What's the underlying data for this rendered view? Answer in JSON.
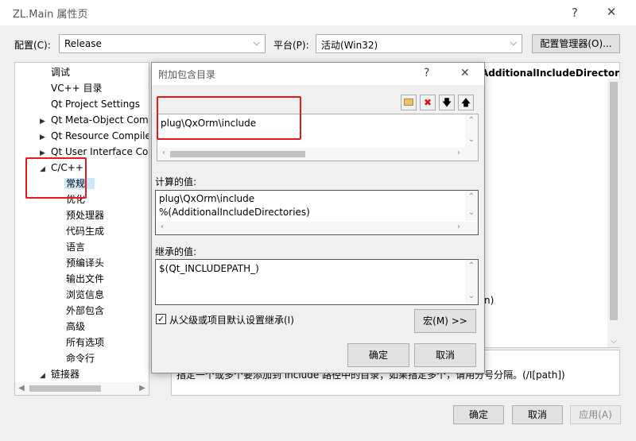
{
  "window": {
    "title": "ZL.Main 属性页",
    "help": "?",
    "close": "✕"
  },
  "config": {
    "label": "配置(C):",
    "value": "Release",
    "platform_label": "平台(P):",
    "platform_value": "活动(Win32)",
    "manager_button": "配置管理器(O)..."
  },
  "tree": {
    "items": [
      {
        "label": "调试"
      },
      {
        "label": "VC++ 目录"
      },
      {
        "label": "Qt Project Settings"
      },
      {
        "label": "Qt Meta-Object Com"
      },
      {
        "label": "Qt Resource Compile"
      },
      {
        "label": "Qt User Interface Co"
      },
      {
        "label": "C/C++"
      },
      {
        "label": "常规"
      },
      {
        "label": "优化"
      },
      {
        "label": "预处理器"
      },
      {
        "label": "代码生成"
      },
      {
        "label": "语言"
      },
      {
        "label": "预编译头"
      },
      {
        "label": "输出文件"
      },
      {
        "label": "浏览信息"
      },
      {
        "label": "外部包含"
      },
      {
        "label": "高级"
      },
      {
        "label": "所有选项"
      },
      {
        "label": "命令行"
      },
      {
        "label": "链接器"
      }
    ],
    "expand_collapsed": "▶",
    "expand_open": "◢"
  },
  "grid": {
    "header_fragment": "AdditionalIncludeDirector",
    "row_fragment": "n)"
  },
  "description": {
    "text": "指定一个或多个要添加到 include 路径中的目录；如果指定多个，请用分号分隔。(/I[path])"
  },
  "dialog": {
    "title": "附加包含目录",
    "help": "?",
    "close": "✕",
    "entry": "plug\\QxOrm\\include",
    "computed_label": "计算的值:",
    "computed_lines": [
      "plug\\QxOrm\\include",
      "%(AdditionalIncludeDirectories)"
    ],
    "inherited_label": "继承的值:",
    "inherited_value": "$(Qt_INCLUDEPATH_)",
    "inherit_checkbox": "从父级或项目默认设置继承(I)",
    "macro_button": "宏(M) >>",
    "ok_button": "确定",
    "cancel_button": "取消"
  },
  "footer": {
    "ok_button": "确定",
    "cancel_button": "取消",
    "apply_button": "应用(A)"
  },
  "colors": {
    "selection": "#cce8ff",
    "highlight_box": "#e8191e",
    "delete_icon": "#d11"
  }
}
